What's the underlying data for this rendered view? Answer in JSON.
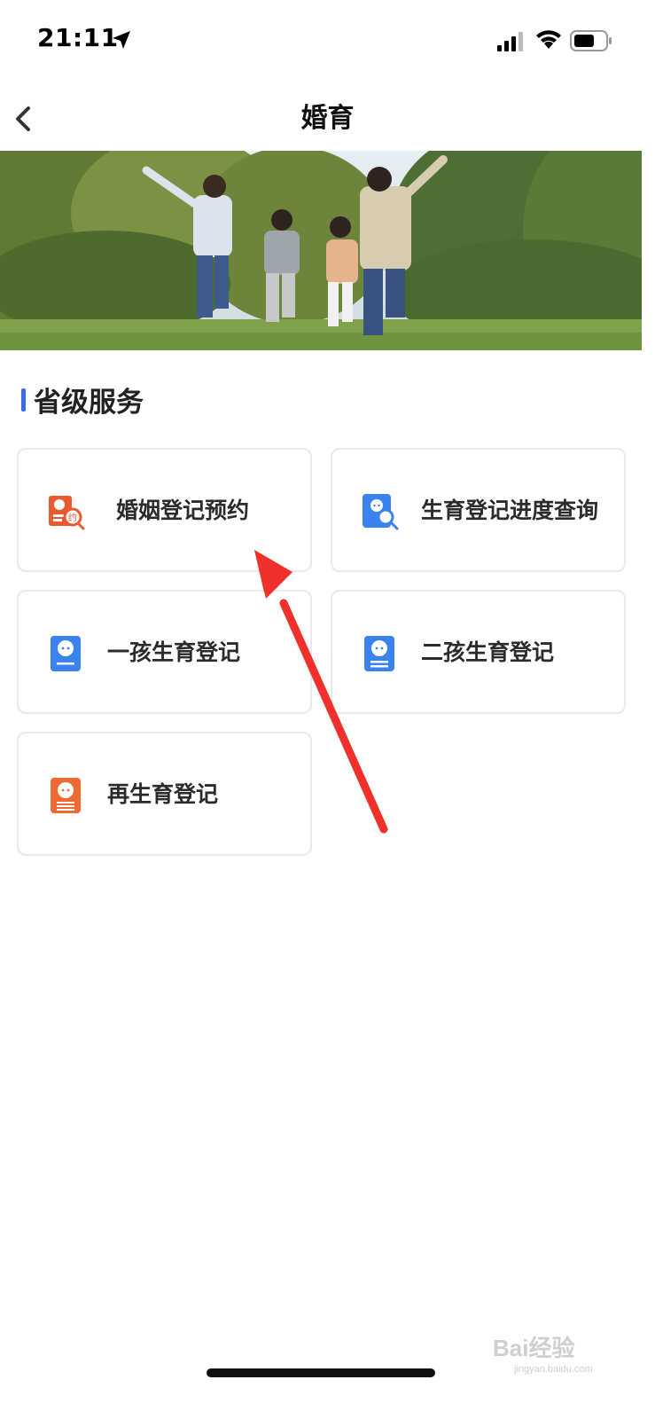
{
  "status_bar": {
    "time": "21:11",
    "icons": [
      "location-arrow-icon",
      "cellular-signal-icon",
      "wifi-icon",
      "battery-icon"
    ]
  },
  "nav": {
    "title": "婚育",
    "back_icon": "chevron-left-icon"
  },
  "banner": {
    "description_icon": "family-running-photo"
  },
  "section": {
    "title": "省级服务",
    "accent_color": "#3d6be0"
  },
  "services": [
    {
      "label": "婚姻登记预约",
      "icon": "marriage-appointment-icon",
      "color": "#e95b2e"
    },
    {
      "label": "生育登记进度查询",
      "icon": "birth-progress-search-icon",
      "color": "#3a82f0"
    },
    {
      "label": "一孩生育登记",
      "icon": "first-child-registration-icon",
      "color": "#3a82f0"
    },
    {
      "label": "二孩生育登记",
      "icon": "second-child-registration-icon",
      "color": "#3a82f0"
    },
    {
      "label": "再生育登记",
      "icon": "re-birth-registration-icon",
      "color": "#ee6a32"
    }
  ],
  "annotation": {
    "arrow_color": "#f0302a"
  },
  "watermark": {
    "brand": "Bai经验",
    "url": "jingyan.baidu.com"
  }
}
